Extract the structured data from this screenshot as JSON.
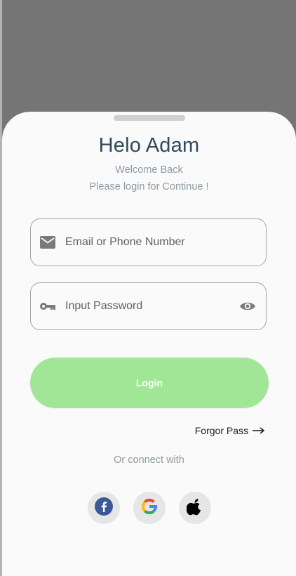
{
  "header": {
    "title": "Helo Adam",
    "welcome": "Welcome Back",
    "instruction": "Please login for Continue !"
  },
  "form": {
    "email_placeholder": "Email or Phone Number",
    "password_placeholder": "Input Password",
    "login_label": "Login",
    "forgot_label": "Forgor Pass"
  },
  "social": {
    "label": "Or connect with",
    "providers": [
      "facebook-icon",
      "google-icon",
      "apple-icon"
    ]
  },
  "colors": {
    "title": "#2e4a5e",
    "login_button": "#a1e597",
    "backdrop": "#757575",
    "sheet": "#fafafa"
  },
  "icons": {
    "email_field": "mail-icon",
    "password_field": "key-icon",
    "password_toggle": "eye-icon",
    "forgot": "arrow-right-icon"
  }
}
